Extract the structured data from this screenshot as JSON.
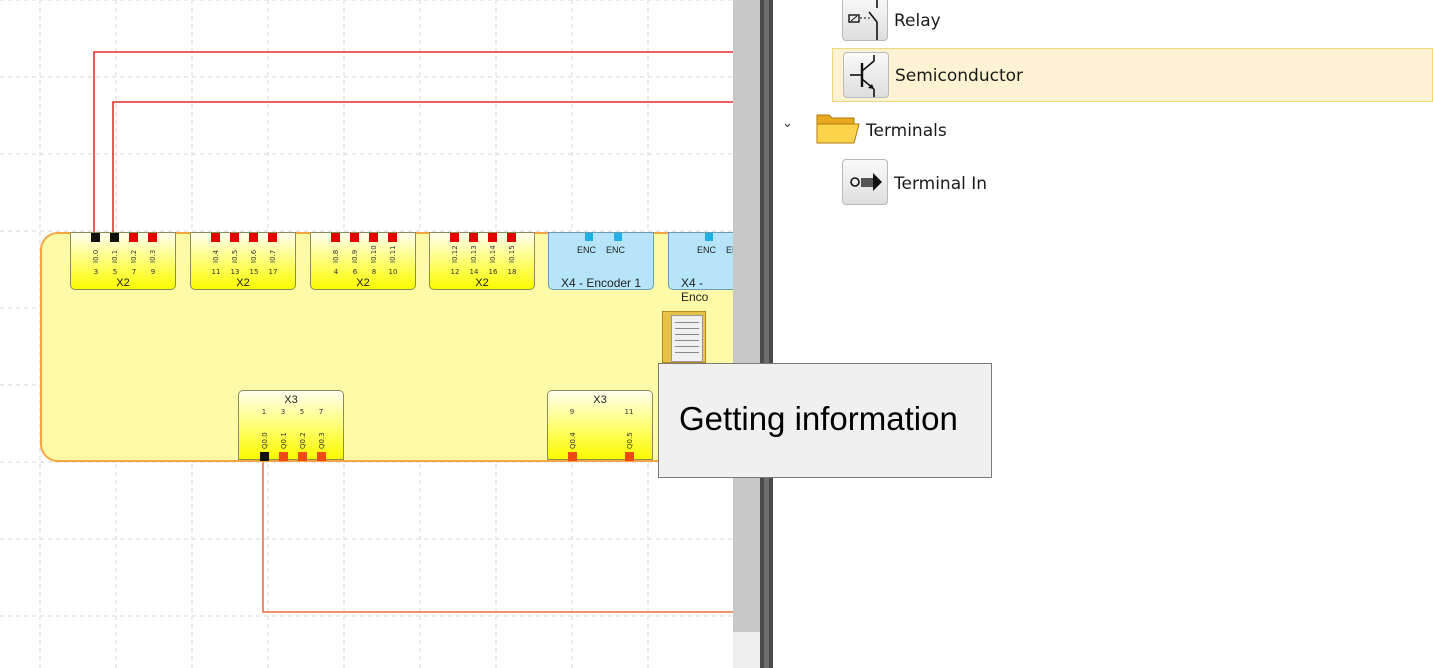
{
  "canvas": {
    "input_groups": [
      {
        "label": "X2",
        "pins": [
          "I0.0",
          "I0.1",
          "I0.2",
          "I0.3"
        ],
        "terminals": [
          "3",
          "5",
          "7",
          "9"
        ],
        "pin_colors": [
          "black",
          "black",
          "red",
          "red"
        ]
      },
      {
        "label": "X2",
        "pins": [
          "I0.4",
          "I0.5",
          "I0.6",
          "I0.7"
        ],
        "terminals": [
          "11",
          "13",
          "15",
          "17"
        ],
        "pin_colors": [
          "red",
          "red",
          "red",
          "red"
        ]
      },
      {
        "label": "X2",
        "pins": [
          "I0.8",
          "I0.9",
          "I0.10",
          "I0.11"
        ],
        "terminals": [
          "4",
          "6",
          "8",
          "10"
        ],
        "pin_colors": [
          "red",
          "red",
          "red",
          "red"
        ]
      },
      {
        "label": "X2",
        "pins": [
          "I0.12",
          "I0.13",
          "I0.14",
          "I0.15"
        ],
        "terminals": [
          "12",
          "14",
          "16",
          "18"
        ],
        "pin_colors": [
          "red",
          "red",
          "red",
          "red"
        ]
      }
    ],
    "encoder_groups": [
      {
        "label": "X4 - Encoder 1",
        "pins": [
          "ENC",
          "ENC"
        ]
      },
      {
        "label": "X4 - Enco",
        "pins": [
          "ENC",
          "EN"
        ]
      }
    ],
    "output_groups": [
      {
        "label": "X3",
        "pins": [
          "Q0.0",
          "Q0.1",
          "Q0.2",
          "Q0.3"
        ],
        "terminals": [
          "1",
          "3",
          "5",
          "7"
        ],
        "pin_colors": [
          "black",
          "orange",
          "orange",
          "orange"
        ]
      },
      {
        "label": "X3",
        "pins": [
          "Q0.4",
          "Q0.5"
        ],
        "terminals": [
          "9",
          "11"
        ],
        "pin_colors": [
          "orange",
          "orange"
        ]
      }
    ],
    "colors": {
      "wire_red": "#e00000",
      "wire_orange": "#e8521c",
      "device_fill": "#fdfba8",
      "device_border": "#f5a642"
    }
  },
  "tree": {
    "items": [
      {
        "label": "Relay",
        "icon": "relay-icon"
      },
      {
        "label": "Semiconductor",
        "icon": "transistor-icon",
        "selected": true
      },
      {
        "label": "Terminals",
        "icon": "folder-open-icon",
        "expanded": true
      },
      {
        "label": "Terminal In",
        "icon": "terminal-in-icon"
      }
    ]
  },
  "tooltip": {
    "text": "Getting information"
  }
}
